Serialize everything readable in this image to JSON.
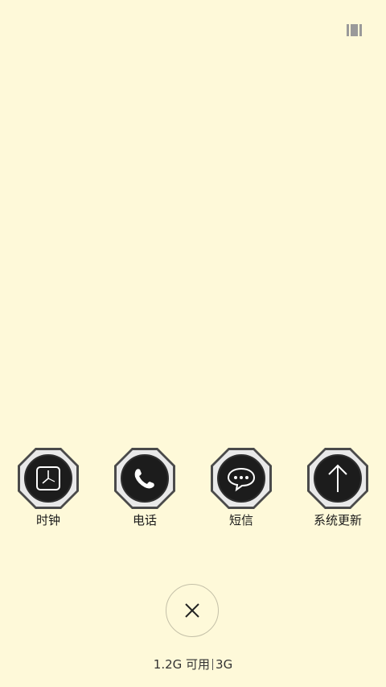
{
  "top_bar": {
    "icon": "memory-clean-icon"
  },
  "apps": [
    {
      "label": "时钟",
      "icon": "clock-icon"
    },
    {
      "label": "电话",
      "icon": "phone-icon"
    },
    {
      "label": "短信",
      "icon": "message-icon"
    },
    {
      "label": "系统更新",
      "icon": "arrow-up-icon"
    }
  ],
  "close_button": {
    "icon": "close-icon"
  },
  "memory": {
    "available": "1.2G 可用",
    "total": "3G"
  },
  "colors": {
    "background": "#fef9d9",
    "badge_dark": "#1c1c1c",
    "badge_ring": "#4a4a4a"
  }
}
